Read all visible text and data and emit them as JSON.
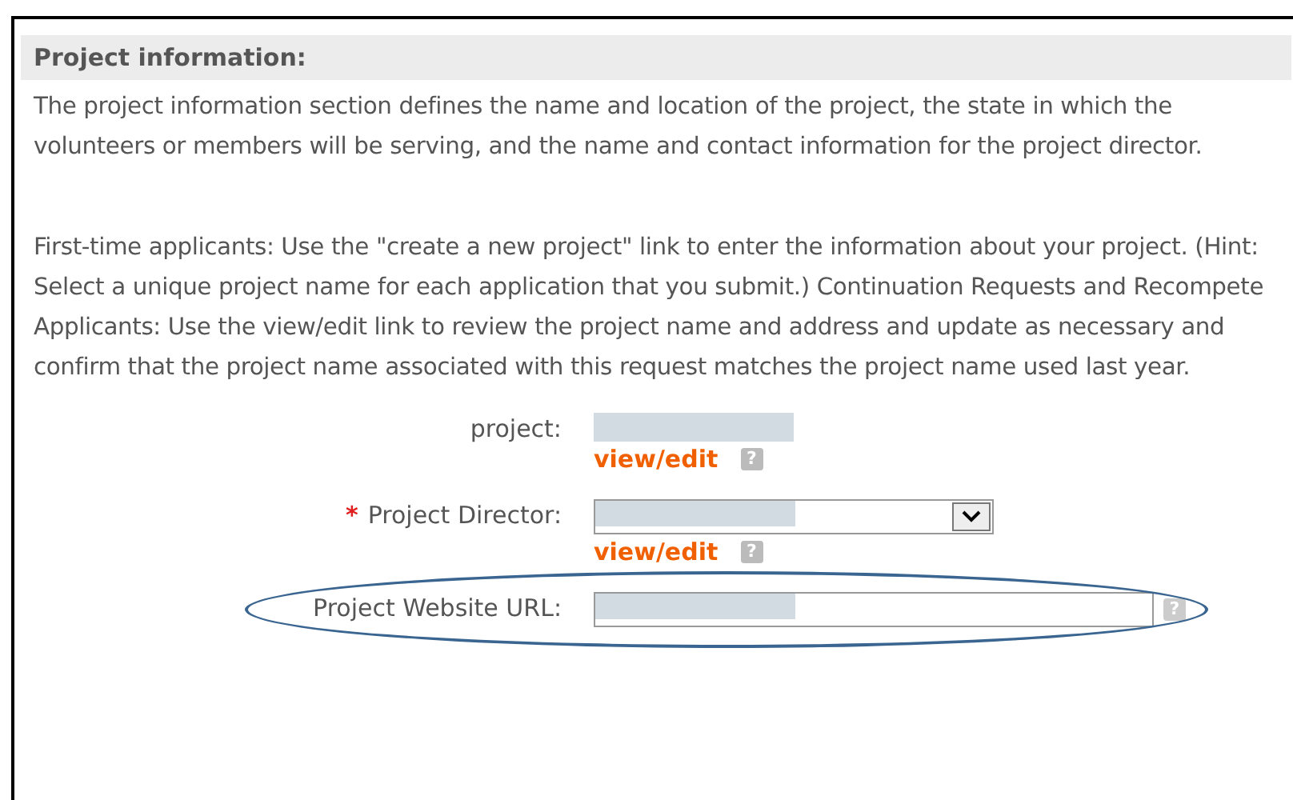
{
  "section": {
    "title": "Project information:",
    "paragraphs": [
      "The project information section defines the name and location of the project, the state in which the volunteers or members will be serving, and the name and contact information for the project director.",
      "First-time applicants: Use the \"create a new project\" link to enter the information about your project. (Hint: Select a unique project name for each application that you submit.) Continuation Requests and Recompete Applicants: Use the view/edit link to review the project name and address and update as necessary and confirm that the project name associated with this request matches the project name used last year."
    ]
  },
  "form": {
    "required_mark": "*",
    "help_glyph": "?",
    "fields": [
      {
        "kind": "text",
        "label": "project:",
        "required": false,
        "link": "view/edit"
      },
      {
        "kind": "select",
        "label": "Project Director:",
        "required": true,
        "link": "view/edit"
      },
      {
        "kind": "input",
        "label": "Project Website URL:",
        "required": false,
        "highlighted": true
      }
    ]
  }
}
